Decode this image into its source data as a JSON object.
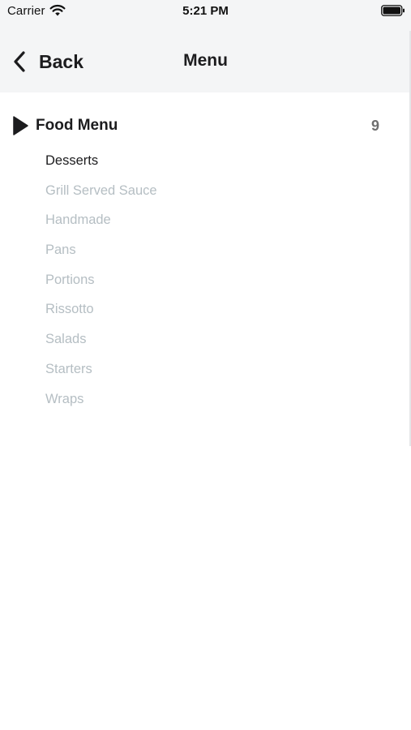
{
  "status_bar": {
    "carrier": "Carrier",
    "time": "5:21 PM",
    "wifi_icon": "wifi-icon",
    "battery_icon": "battery-icon"
  },
  "nav": {
    "back_label": "Back",
    "title": "Menu",
    "back_icon": "chevron-left-icon",
    "background": "#f4f5f6"
  },
  "menu_group": {
    "title": "Food Menu",
    "count": "9",
    "expand_icon": "play-icon",
    "items": [
      {
        "label": "Desserts",
        "active": true
      },
      {
        "label": "Grill Served Sauce",
        "active": false
      },
      {
        "label": "Handmade",
        "active": false
      },
      {
        "label": "Pans",
        "active": false
      },
      {
        "label": "Portions",
        "active": false
      },
      {
        "label": "Rissotto",
        "active": false
      },
      {
        "label": "Salads",
        "active": false
      },
      {
        "label": "Starters",
        "active": false
      },
      {
        "label": "Wraps",
        "active": false
      }
    ]
  },
  "colors": {
    "active_text": "#1c1c1e",
    "inactive_text": "#b5bec3",
    "count_text": "#6e6e6e"
  }
}
